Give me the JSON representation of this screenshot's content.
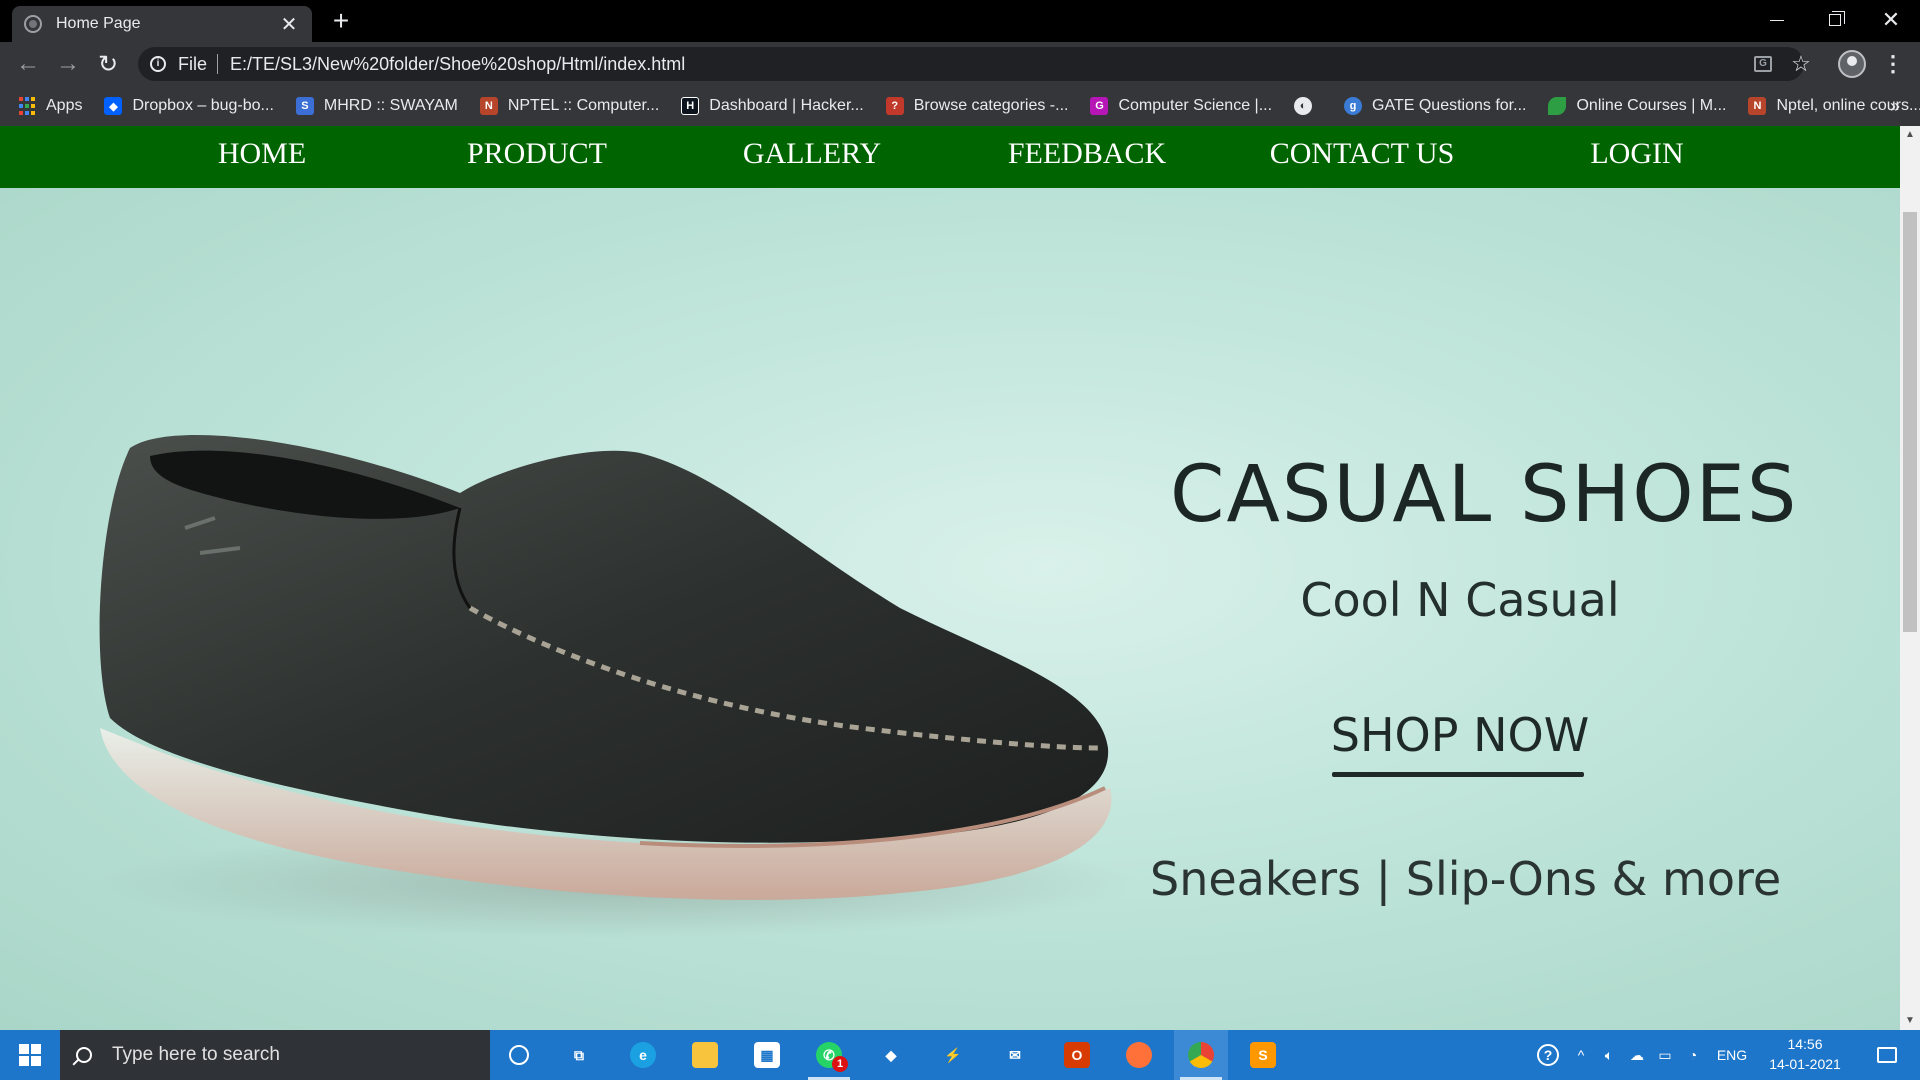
{
  "browser": {
    "tab_title": "Home Page",
    "tab_close": "✕",
    "new_tab": "+",
    "scheme_label": "File",
    "url": "E:/TE/SL3/New%20folder/Shoe%20shop/Html/index.html",
    "more_bookmarks": "»",
    "bookmarks": [
      {
        "label": "Apps",
        "icon": "apps-grid-icon"
      },
      {
        "label": "Dropbox – bug-bo...",
        "icon": "dropbox-icon",
        "color": "#0061ff"
      },
      {
        "label": "MHRD :: SWAYAM",
        "icon": "swayam-icon",
        "color": "#3b6fd6"
      },
      {
        "label": "NPTEL :: Computer...",
        "icon": "nptel-icon",
        "color": "#b7452b"
      },
      {
        "label": "Dashboard | Hacker...",
        "icon": "hackerrank-icon",
        "color": "#0e141e"
      },
      {
        "label": "Browse categories -...",
        "icon": "browse-icon",
        "color": "#c0392b"
      },
      {
        "label": "Computer Science |...",
        "icon": "g-icon",
        "color": "#b516b5"
      },
      {
        "label": "",
        "icon": "globe-icon",
        "color": "#555"
      },
      {
        "label": "GATE Questions for...",
        "icon": "gate-icon",
        "color": "#3a7bd5"
      },
      {
        "label": "Online Courses | M...",
        "icon": "leaf-icon",
        "color": "#2e9e44"
      },
      {
        "label": "Nptel, online cours...",
        "icon": "nptel2-icon",
        "color": "#b7452b"
      }
    ]
  },
  "site": {
    "nav": [
      "HOME",
      "PRODUCT",
      "GALLERY",
      "FEEDBACK",
      "CONTACT US",
      "LOGIN"
    ],
    "nav_color": "#006400",
    "hero": {
      "title": "CASUAL SHOES",
      "subtitle": "Cool N Casual",
      "cta": "SHOP NOW",
      "tagline": "Sneakers | Slip-Ons & more"
    }
  },
  "taskbar": {
    "search_placeholder": "Type here to search",
    "lang": "ENG",
    "time": "14:56",
    "date": "14-01-2021",
    "mail_badge": "1"
  }
}
